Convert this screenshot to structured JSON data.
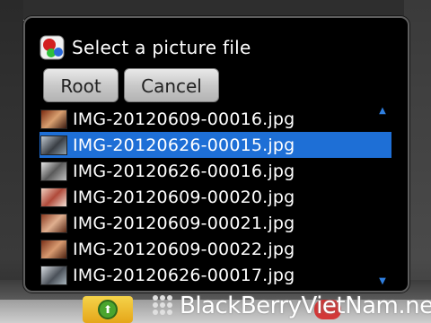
{
  "dialog": {
    "title": "Select a picture file",
    "buttons": {
      "root_label": "Root",
      "cancel_label": "Cancel"
    },
    "files": [
      {
        "name": "IMG-20120609-00016.jpg",
        "selected": false
      },
      {
        "name": "IMG-20120626-00015.jpg",
        "selected": true
      },
      {
        "name": "IMG-20120626-00016.jpg",
        "selected": false
      },
      {
        "name": "IMG-20120609-00020.jpg",
        "selected": false
      },
      {
        "name": "IMG-20120609-00021.jpg",
        "selected": false
      },
      {
        "name": "IMG-20120609-00022.jpg",
        "selected": false
      },
      {
        "name": "IMG-20120626-00017.jpg",
        "selected": false
      }
    ]
  },
  "watermark": {
    "text": "BlackBerryVietNam.net"
  },
  "colors": {
    "selection": "#1e6fd6",
    "dialog_bg": "#000000",
    "scroll_arrow": "#2f7fe0"
  }
}
